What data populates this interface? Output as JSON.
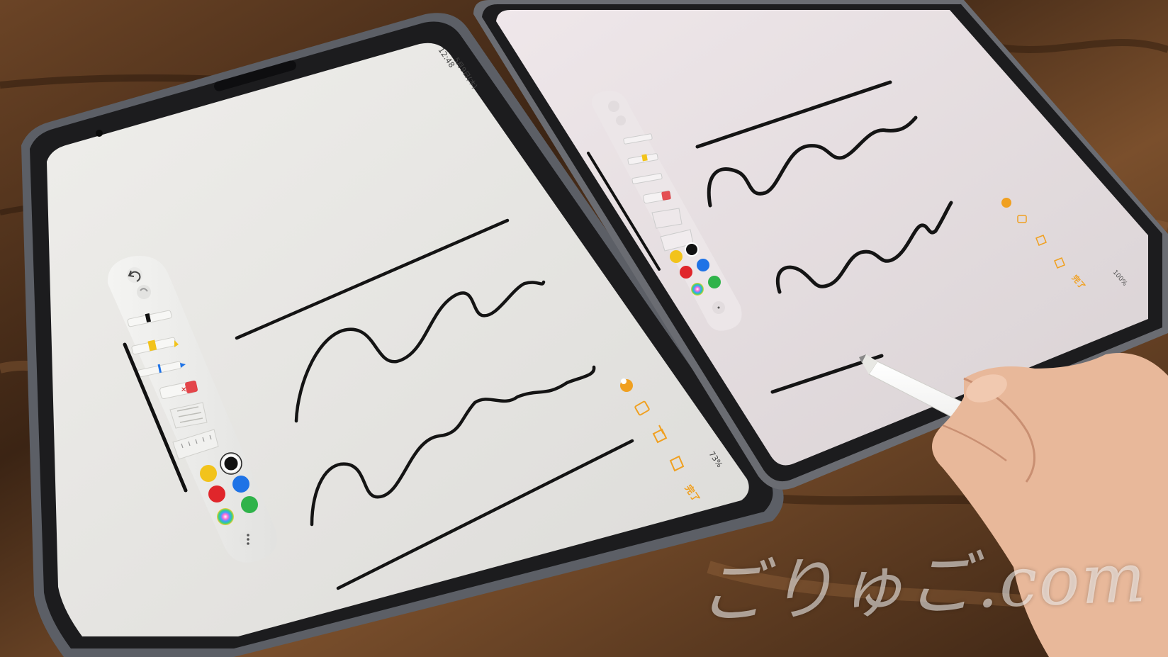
{
  "colors": {
    "wood_dark": "#3b2414",
    "wood_mid": "#6b4426",
    "wood_light": "#8a5a34",
    "bezel": "#1c1c1e",
    "frame": "#5c5f66",
    "screen_left": "#e7e6e3",
    "screen_right": "#e4dcde",
    "ink": "#141414",
    "palette_yellow": "#f2c31b",
    "palette_blue": "#1f73e6",
    "palette_red": "#e0262b",
    "palette_green": "#2fb34a",
    "palette_black": "#111111",
    "accent_orange": "#f0a020",
    "pencil": "#f1f1ee",
    "skin": "#e8b89a"
  },
  "left_ipad": {
    "status_bar": {
      "time": "12:48",
      "date": "5月9日(木)",
      "battery": "73%"
    },
    "toolbar_icons": [
      "undo-icon",
      "redo-icon",
      "pen-icon",
      "marker-icon",
      "pencil-tool-icon",
      "eraser-icon",
      "lasso-icon",
      "ruler-icon",
      "more-icon"
    ],
    "side_actions": {
      "done": "完了"
    }
  },
  "right_ipad": {
    "status_bar": {
      "battery": "100%"
    },
    "side_actions": {
      "done": "完了"
    }
  },
  "watermark": "ごりゅご.com"
}
